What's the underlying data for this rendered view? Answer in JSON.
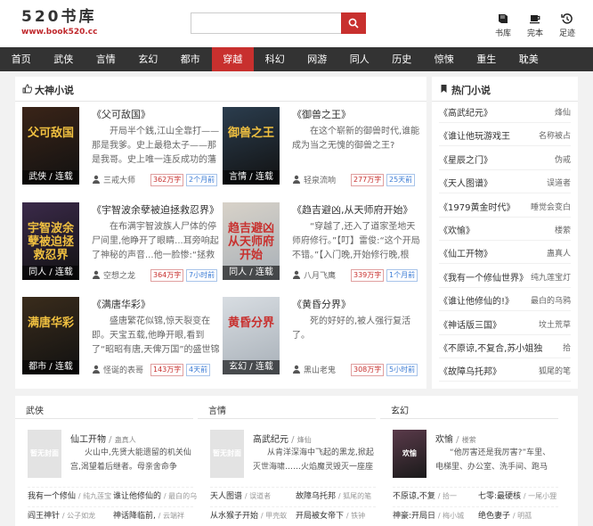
{
  "header": {
    "logo_title": "520书库",
    "logo_url": "www.book520.cc",
    "search_placeholder": "",
    "icons": [
      {
        "label": "书库",
        "icon": "book-icon"
      },
      {
        "label": "完本",
        "icon": "cup-icon"
      },
      {
        "label": "足迹",
        "icon": "history-icon"
      }
    ]
  },
  "nav": {
    "items": [
      "首页",
      "武侠",
      "言情",
      "玄幻",
      "都市",
      "穿越",
      "科幻",
      "网游",
      "同人",
      "历史",
      "惊悚",
      "重生",
      "耽美"
    ],
    "active_index": 5
  },
  "featured": {
    "title": "大神小说",
    "books": [
      {
        "name": "《父可敌国》",
        "desc": "开局半个銭,江山全靠打——那是我爹。史上最稳太子——那是我哥。史上唯一连反成功的藩王,征北",
        "author": "三戒大师",
        "words": "362万字",
        "time": "2个月前",
        "tag": "武侠 / 连载",
        "cover_text": "父可敌国",
        "cover_color": "#3a2418"
      },
      {
        "name": "《御兽之王》",
        "desc": "在这个崭新的御兽时代,谁能成为当之无愧的御兽之王?",
        "author": "轻泉流响",
        "words": "277万字",
        "time": "25天前",
        "tag": "言情 / 连载",
        "cover_text": "御兽之王",
        "cover_color": "#2b3d4e"
      },
      {
        "name": "《宇智波余孽被迫拯救忍界》",
        "desc": "在布满宇智波族人尸体的停尸间里,他睁开了眼睛...耳旁响起了神秘的声音...他一脸惨:“拯救忍",
        "author": "空想之龙",
        "words": "364万字",
        "time": "7小时前",
        "tag": "同人 / 连载",
        "cover_text": "宇智波余孽被迫拯救忍界",
        "cover_color": "#3b2a4a"
      },
      {
        "name": "《趋吉避凶,从天师府开始》",
        "desc": "“穿越了,还入了道家圣地天师府修行。”【叮】雷俊:“这个开局不错。”【入门晚,开始修行晚,根",
        "author": "八月飞鹰",
        "words": "339万字",
        "time": "1个月前",
        "tag": "同人 / 连载",
        "cover_text": "趋吉避凶 从天师府开始",
        "cover_color": "#d8d2c8"
      },
      {
        "name": "《满唐华彩》",
        "desc": "盛唐繁花似锦,惊天裂变在即。天宝五载,他睁开眼,看到了“昭昭有唐,天俾万国”的盛世锦",
        "author": "怪诞的表哥",
        "words": "143万字",
        "time": "4天前",
        "tag": "都市 / 连载",
        "cover_text": "满唐华彩",
        "cover_color": "#3a2c1c"
      },
      {
        "name": "《黄昏分界》",
        "desc": "死的好好的,被人强行复活了。",
        "author": "黑山老鬼",
        "words": "308万字",
        "time": "5小时前",
        "tag": "玄幻 / 连载",
        "cover_text": "黄昏分界",
        "cover_color": "#d8dde2"
      }
    ]
  },
  "hot": {
    "title": "热门小说",
    "items": [
      {
        "name": "《高武纪元》",
        "author": "烽仙"
      },
      {
        "name": "《谁让他玩游戏王",
        "author": "名称被占"
      },
      {
        "name": "《星辰之门》",
        "author": "伪戒"
      },
      {
        "name": "《天人图谱》",
        "author": "误道者"
      },
      {
        "name": "《1979黄金时代》",
        "author": "睡觉会变白"
      },
      {
        "name": "《欢愉》",
        "author": "楼萦"
      },
      {
        "name": "《仙工开物》",
        "author": "蛊真人"
      },
      {
        "name": "《我有一个修仙世界》",
        "author": "纯九莲宝灯"
      },
      {
        "name": "《谁让他修仙的!》",
        "author": "最白的乌鸦"
      },
      {
        "name": "《神话版三国》",
        "author": "坟土荒草"
      },
      {
        "name": "《不原谅,不复合,苏小姐独",
        "author": "拾"
      },
      {
        "name": "《故障乌托邦》",
        "author": "狐尾的笔"
      }
    ]
  },
  "categories": [
    {
      "title": "武侠",
      "feature": {
        "name": "仙工开物",
        "author": "蛊真人",
        "desc": "火山中,先贤大能遗留的机关仙宫,渴望着后继者。母亲舍命争",
        "cover_text": "暂无封面"
      },
      "rows": [
        [
          {
            "name": "我有一个修仙",
            "author": "纯九莲宝"
          },
          {
            "name": "谁让他修仙的",
            "author": "最白的乌"
          }
        ],
        [
          {
            "name": "阎王神针",
            "author": "公子如龙"
          },
          {
            "name": "神话降临前,",
            "author": "云端祥"
          }
        ]
      ]
    },
    {
      "title": "言情",
      "feature": {
        "name": "高武纪元",
        "author": "烽仙",
        "desc": "从肯洋深海中飞起的黑龙,掀起灭世海啸……火焰魔灵毁灭一座座",
        "cover_text": "暂无封面"
      },
      "rows": [
        [
          {
            "name": "天人图谱",
            "author": "误道者"
          },
          {
            "name": "故障乌托邦",
            "author": "狐尾的笔"
          }
        ],
        [
          {
            "name": "从水猴子开始",
            "author": "甲壳蚁"
          },
          {
            "name": "开局被女帝下",
            "author": "铁钟"
          }
        ]
      ]
    },
    {
      "title": "玄幻",
      "feature": {
        "name": "欢愉",
        "author": "楼萦",
        "desc": "“他厉害还是我厉害?”车里、电梯里、办公室、洗手间、跑马",
        "cover_text": "欢愉",
        "cover_color": "#5a3a4a"
      },
      "rows": [
        [
          {
            "name": "不原谅,不复",
            "author": "拾一"
          },
          {
            "name": "七零:最硬核",
            "author": "一尾小狸"
          }
        ],
        [
          {
            "name": "神豪:开局日",
            "author": "梅小城"
          },
          {
            "name": "绝色妻子",
            "author": "明孤"
          }
        ]
      ]
    }
  ]
}
